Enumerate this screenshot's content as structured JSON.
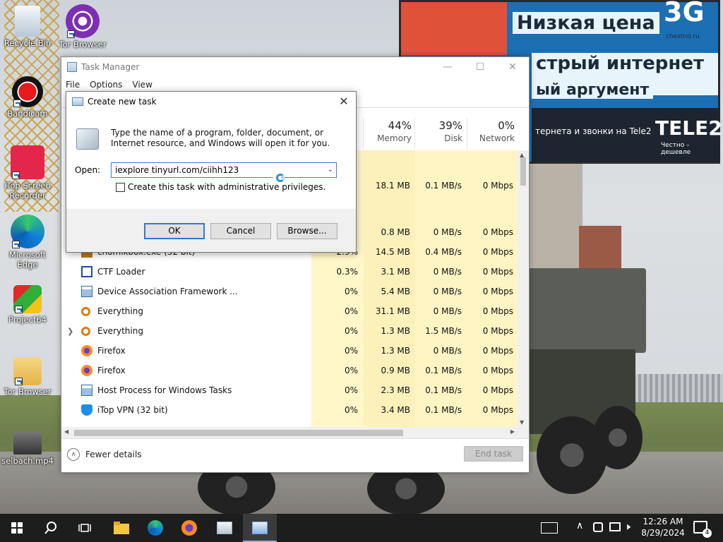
{
  "desktop": {
    "icons": [
      {
        "label": "Recycle Bin"
      },
      {
        "label": "Tor Browser"
      },
      {
        "label": "Bandicam"
      },
      {
        "label": "iTop Screen Recorder"
      },
      {
        "label": "Microsoft Edge"
      },
      {
        "label": "Project64"
      },
      {
        "label": "Tor Browser"
      },
      {
        "label": "selbach.mp4"
      }
    ],
    "billboard": {
      "badge": "3G",
      "site": "chestno.ru",
      "line1": "Низкая цена",
      "line2": "стрый интернет –",
      "line3": "ый аргумент",
      "line4": "тернета и звонки на Tele2",
      "brand": "TELE2",
      "brand_sub": "Честно – дешевле"
    }
  },
  "task_manager": {
    "title": "Task Manager",
    "menu": [
      "File",
      "Options",
      "View"
    ],
    "columns": [
      {
        "percent": "44%",
        "name": "Memory"
      },
      {
        "percent": "39%",
        "name": "Disk"
      },
      {
        "percent": "0%",
        "name": "Network"
      }
    ],
    "rows": [
      {
        "name": "",
        "cpu": "",
        "memory": "18.1 MB",
        "disk": "0.1 MB/s",
        "network": "0 Mbps"
      },
      {
        "name": "",
        "cpu": "",
        "memory": "0.8 MB",
        "disk": "0 MB/s",
        "network": "0 Mbps"
      },
      {
        "name": "chomikbox.exe (32 bit)",
        "cpu": "2.9%",
        "memory": "14.5 MB",
        "disk": "0.4 MB/s",
        "network": "0 Mbps"
      },
      {
        "name": "CTF Loader",
        "cpu": "0.3%",
        "memory": "3.1 MB",
        "disk": "0 MB/s",
        "network": "0 Mbps"
      },
      {
        "name": "Device Association Framework ...",
        "cpu": "0%",
        "memory": "5.4 MB",
        "disk": "0 MB/s",
        "network": "0 Mbps"
      },
      {
        "name": "Everything",
        "cpu": "0%",
        "memory": "31.1 MB",
        "disk": "0 MB/s",
        "network": "0 Mbps"
      },
      {
        "name": "Everything",
        "cpu": "0%",
        "memory": "1.3 MB",
        "disk": "1.5 MB/s",
        "network": "0 Mbps"
      },
      {
        "name": "Firefox",
        "cpu": "0%",
        "memory": "1.3 MB",
        "disk": "0 MB/s",
        "network": "0 Mbps"
      },
      {
        "name": "Firefox",
        "cpu": "0%",
        "memory": "0.9 MB",
        "disk": "0.1 MB/s",
        "network": "0 Mbps"
      },
      {
        "name": "Host Process for Windows Tasks",
        "cpu": "0%",
        "memory": "2.3 MB",
        "disk": "0.1 MB/s",
        "network": "0 Mbps"
      },
      {
        "name": "iTop VPN (32 bit)",
        "cpu": "0%",
        "memory": "3.4 MB",
        "disk": "0.1 MB/s",
        "network": "0 Mbps"
      }
    ],
    "footer": {
      "fewer_details": "Fewer details",
      "end_task": "End task"
    }
  },
  "dialog": {
    "title": "Create new task",
    "message": "Type the name of a program, folder, document, or Internet resource, and Windows will open it for you.",
    "open_label": "Open:",
    "open_value": "iexplore tinyurl.com/ciihh123",
    "admin_checkbox": "Create this task with administrative privileges.",
    "ok": "OK",
    "cancel": "Cancel",
    "browse": "Browse..."
  },
  "taskbar": {
    "time": "12:26 AM",
    "date": "8/29/2024",
    "notifications": "4"
  }
}
